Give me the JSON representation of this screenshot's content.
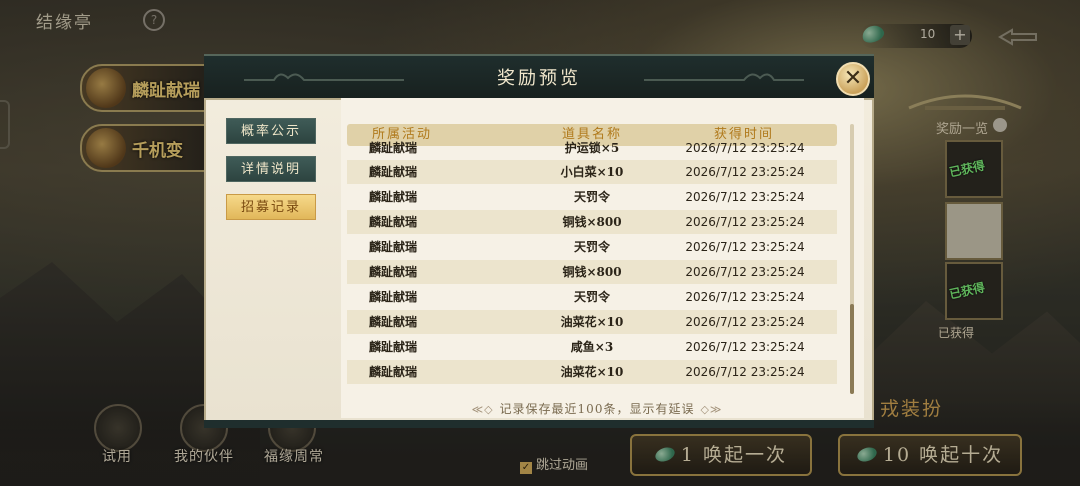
{
  "top_bar": {
    "location_title": "结缘亭",
    "help_symbol": "?",
    "currency_amount": "10",
    "add_symbol": "+"
  },
  "left_banners": [
    {
      "text": "麟趾献瑞"
    },
    {
      "text": "千机变"
    }
  ],
  "reward_sidebar": {
    "title": "奖励一览",
    "cards": [
      {
        "tag": "已获得"
      },
      {
        "tag": ""
      },
      {
        "tag": "已获得"
      }
    ],
    "obtained_label": "已获得"
  },
  "dress_text": "戎装扮",
  "bottom_bar": {
    "items": [
      {
        "label": "试用"
      },
      {
        "label": "我的伙伴"
      },
      {
        "label": "福缘周常"
      }
    ],
    "skip_animation": "跳过动画",
    "skip_checked": true,
    "summon_once": "1 唤起一次",
    "summon_ten": "10 唤起十次"
  },
  "modal": {
    "title": "奖励预览",
    "close_symbol": "✕",
    "side_tabs": [
      {
        "label": "概率公示",
        "active": false
      },
      {
        "label": "详情说明",
        "active": false
      },
      {
        "label": "招募记录",
        "active": true
      }
    ],
    "columns": [
      "所属活动",
      "道具名称",
      "获得时间"
    ],
    "rows": [
      {
        "activity": "麟趾献瑞",
        "item": "护运锁×5",
        "time": "2026/7/12 23:25:24"
      },
      {
        "activity": "麟趾献瑞",
        "item": "小白菜×10",
        "time": "2026/7/12 23:25:24"
      },
      {
        "activity": "麟趾献瑞",
        "item": "天罚令",
        "time": "2026/7/12 23:25:24"
      },
      {
        "activity": "麟趾献瑞",
        "item": "铜钱×800",
        "time": "2026/7/12 23:25:24"
      },
      {
        "activity": "麟趾献瑞",
        "item": "天罚令",
        "time": "2026/7/12 23:25:24"
      },
      {
        "activity": "麟趾献瑞",
        "item": "铜钱×800",
        "time": "2026/7/12 23:25:24"
      },
      {
        "activity": "麟趾献瑞",
        "item": "天罚令",
        "time": "2026/7/12 23:25:24"
      },
      {
        "activity": "麟趾献瑞",
        "item": "油菜花×10",
        "time": "2026/7/12 23:25:24"
      },
      {
        "activity": "麟趾献瑞",
        "item": "咸鱼×3",
        "time": "2026/7/12 23:25:24"
      },
      {
        "activity": "麟趾献瑞",
        "item": "油菜花×10",
        "time": "2026/7/12 23:25:24"
      }
    ],
    "footnote": "记录保存最近100条，显示有延误"
  },
  "colors": {
    "header_gold": "#b07a1c",
    "active_tab": "#e1b75a",
    "tab_teal": "#3f5b57"
  }
}
